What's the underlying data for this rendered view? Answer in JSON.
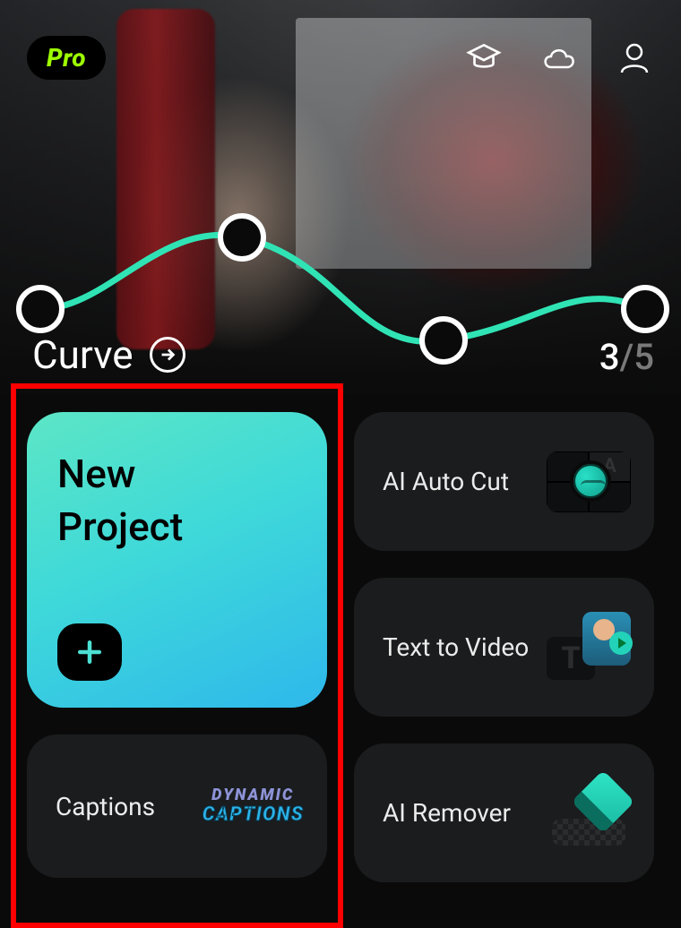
{
  "header": {
    "pro_label": "Pro"
  },
  "hero": {
    "curve_label": "Curve",
    "counter_current": "3",
    "counter_total": "/5"
  },
  "cards": {
    "new_project": "New\nProject",
    "ai_auto_cut": "AI Auto Cut",
    "text_to_video": "Text to Video",
    "captions": "Captions",
    "captions_badge_line1": "DYNAMIC",
    "captions_badge_line2": "CAPTIONS",
    "ai_remover": "AI Remover",
    "ttv_T": "T",
    "aac_A": "A"
  }
}
